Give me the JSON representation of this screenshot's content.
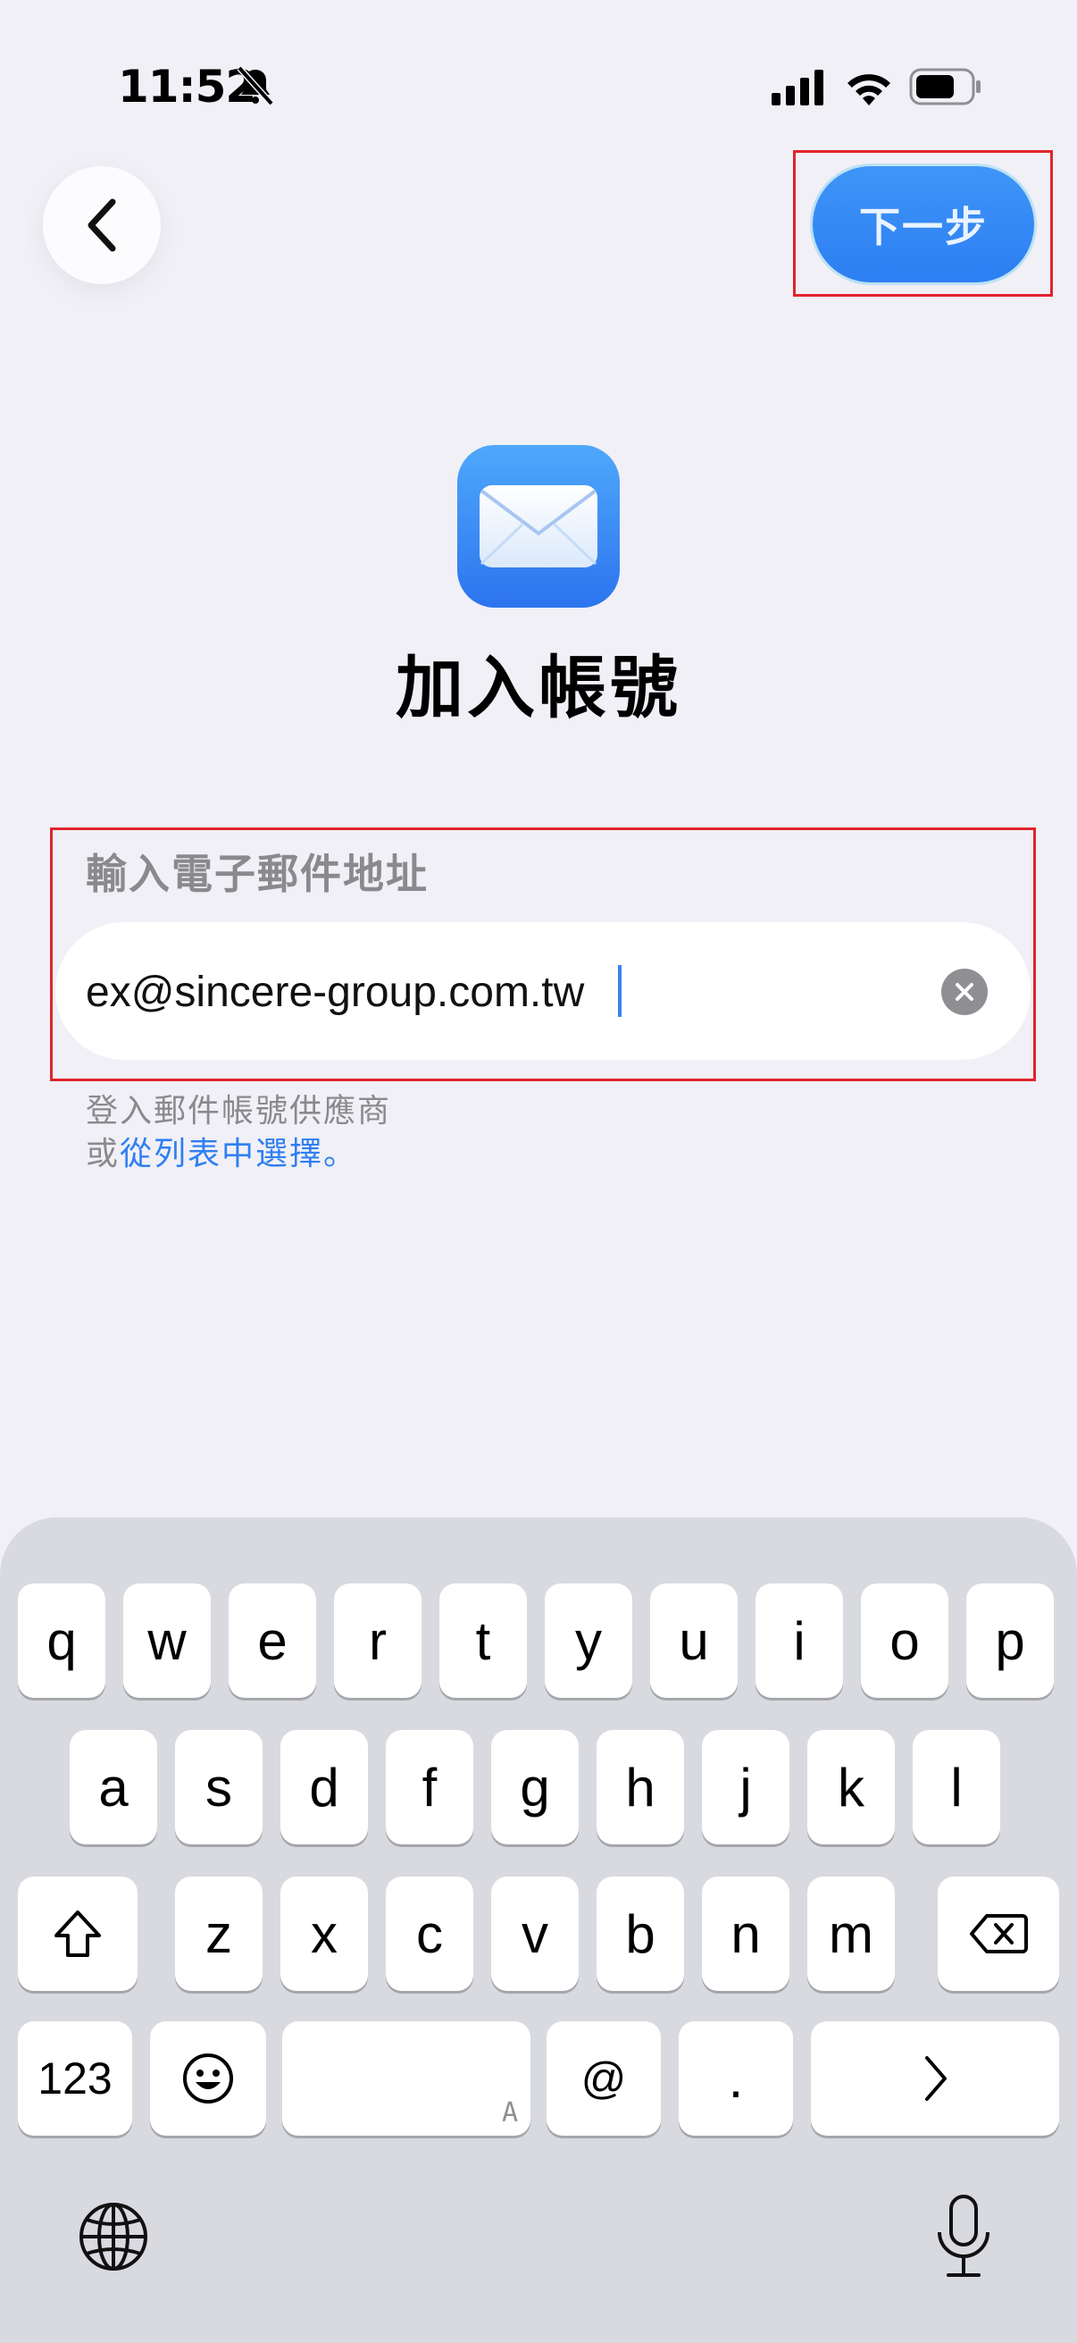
{
  "status_bar": {
    "time": "11:52",
    "silent": true
  },
  "nav": {
    "next_label": "下一步"
  },
  "header": {
    "title": "加入帳號"
  },
  "form": {
    "label": "輸入電子郵件地址",
    "email_value": "ex@sincere-group.com.tw",
    "help_line1": "登入郵件帳號供應商",
    "help_prefix": "或",
    "help_link": "從列表中選擇",
    "help_suffix": "。"
  },
  "keyboard": {
    "row1": [
      "q",
      "w",
      "e",
      "r",
      "t",
      "y",
      "u",
      "i",
      "o",
      "p"
    ],
    "row2": [
      "a",
      "s",
      "d",
      "f",
      "g",
      "h",
      "j",
      "k",
      "l"
    ],
    "row3": [
      "z",
      "x",
      "c",
      "v",
      "b",
      "n",
      "m"
    ],
    "numbers_label": "123",
    "at_label": "@",
    "period_label": ".",
    "space_hint": "A"
  },
  "colors": {
    "accent": "#2f7ff2",
    "background": "#f1f0f6",
    "highlight": "#e0242c"
  },
  "icons": [
    "back-chevron-icon",
    "bell-slash-icon",
    "signal-icon",
    "wifi-icon",
    "battery-icon",
    "mail-icon",
    "clear-icon",
    "shift-icon",
    "delete-icon",
    "emoji-icon",
    "return-arrow-icon",
    "globe-icon",
    "microphone-icon"
  ]
}
